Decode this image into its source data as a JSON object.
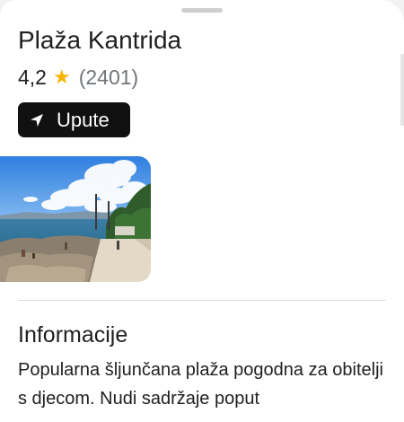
{
  "place": {
    "name": "Plaža Kantrida",
    "rating": "4,2",
    "rating_icon": "star-icon",
    "review_count": "(2401)"
  },
  "actions": {
    "directions_label": "Upute",
    "directions_icon": "navigation-arrow-icon"
  },
  "info": {
    "heading": "Informacije",
    "description": "Popularna šljunčana plaža pogodna za obitelji s djecom. Nudi sadržaje poput"
  },
  "colors": {
    "star": "#f4b400",
    "button_bg": "#111111",
    "button_text": "#ffffff",
    "review_count": "#70757a"
  }
}
